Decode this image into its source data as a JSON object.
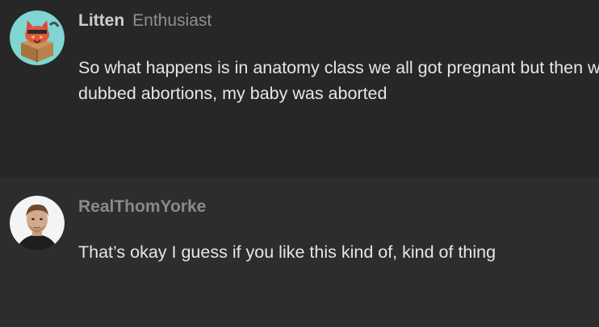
{
  "posts": [
    {
      "username": "Litten",
      "role": "Enthusiast",
      "avatar_icon": "litten-cat-avatar-icon",
      "body": "So what happens is in anatomy class we all got pregnant but then we had dubbed abortions, my baby was aborted"
    },
    {
      "username": "RealThomYorke",
      "role": "",
      "avatar_icon": "man-portrait-avatar-icon",
      "body": "That’s okay I guess if you like this kind of, kind of thing"
    }
  ],
  "colors": {
    "background_first": "#272727",
    "background_second": "#2d2d2d",
    "username": "#cfcfcf",
    "username_muted": "#8a8a8a",
    "role": "#8f8f8f",
    "body": "#e6e6e6",
    "avatar_teal": "#7fd6d2"
  }
}
